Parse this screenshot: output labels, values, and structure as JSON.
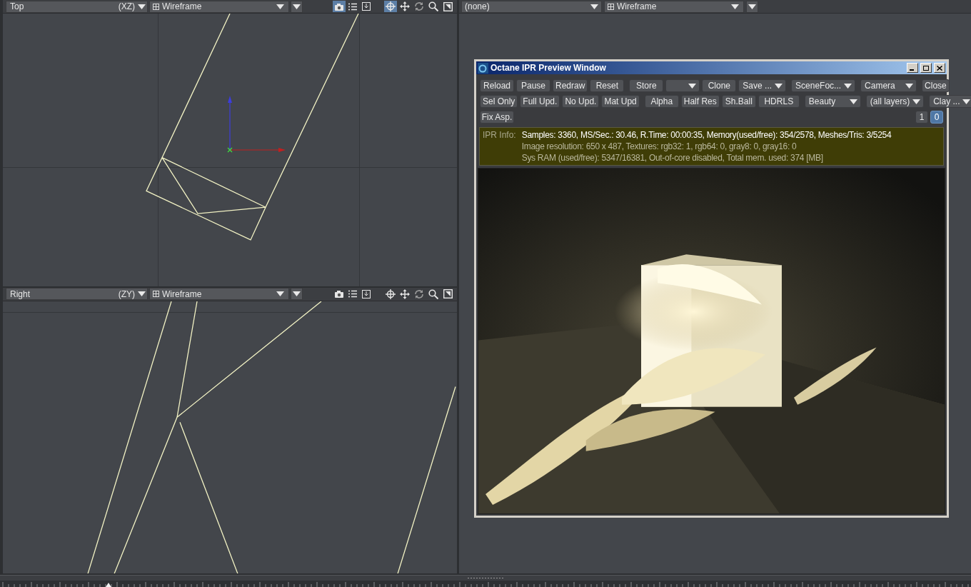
{
  "viewports": [
    {
      "view": "Top",
      "axes": "(XZ)",
      "mode": "Wireframe",
      "tools": [
        {
          "kind": "camera",
          "on": true
        },
        {
          "kind": "list",
          "on": false
        },
        {
          "kind": "save",
          "on": false
        },
        {
          "kind": "center",
          "on": true
        },
        {
          "kind": "move",
          "on": false
        },
        {
          "kind": "rotate",
          "on": false
        },
        {
          "kind": "zoom",
          "on": false
        },
        {
          "kind": "maximize",
          "on": false
        }
      ]
    },
    {
      "view": "Right",
      "axes": "(ZY)",
      "mode": "Wireframe",
      "tools": [
        {
          "kind": "camera",
          "on": false
        },
        {
          "kind": "list",
          "on": false
        },
        {
          "kind": "save",
          "on": false
        },
        {
          "kind": "center",
          "on": false
        },
        {
          "kind": "move",
          "on": false
        },
        {
          "kind": "rotate",
          "on": false
        },
        {
          "kind": "zoom",
          "on": false
        },
        {
          "kind": "maximize",
          "on": false
        }
      ]
    }
  ],
  "right_viewport": {
    "camera": "(none)",
    "mode": "Wireframe"
  },
  "ipr_window": {
    "title": "Octane IPR Preview Window",
    "toolbar": [
      [
        [
          {
            "kind": "button",
            "label": "Reload"
          },
          {
            "kind": "button",
            "label": "Pause"
          },
          {
            "kind": "button",
            "label": "Redraw"
          },
          {
            "kind": "button",
            "label": "Reset"
          }
        ],
        [
          {
            "kind": "button",
            "label": "Store"
          },
          {
            "kind": "dropdown"
          },
          {
            "kind": "button",
            "label": "Clone"
          },
          {
            "kind": "dropdown",
            "label": "Save ..."
          }
        ],
        [
          {
            "kind": "dropdown",
            "label": "SceneFoc..."
          },
          {
            "kind": "dropdown",
            "label": "Camera"
          }
        ],
        [
          {
            "kind": "button",
            "label": "Close"
          }
        ]
      ],
      [
        [
          {
            "kind": "button",
            "label": "Sel Only"
          },
          {
            "kind": "button",
            "label": "Full Upd."
          },
          {
            "kind": "button",
            "label": "No Upd."
          },
          {
            "kind": "button",
            "label": "Mat Upd"
          }
        ],
        [
          {
            "kind": "button",
            "label": "Alpha"
          },
          {
            "kind": "button",
            "label": "Half Res"
          },
          {
            "kind": "button",
            "label": "Sh.Ball"
          },
          {
            "kind": "button",
            "label": "HDRLS"
          }
        ],
        [
          {
            "kind": "dropdown",
            "label": "Beauty"
          },
          {
            "kind": "dropdown",
            "label": "(all layers)"
          }
        ],
        [
          {
            "kind": "dropdown",
            "label": "Clay ..."
          }
        ]
      ]
    ],
    "extra_button": "Fix Asp.",
    "pages": [
      {
        "label": "1",
        "selected": false
      },
      {
        "label": "0",
        "selected": true
      }
    ],
    "info": {
      "label": "IPR Info:",
      "lines": [
        "Samples: 3360, MS/Sec.: 30.46, R.Time: 00:00:35, Memory(used/free): 354/2578, Meshes/Tris: 3/5254",
        "Image resolution: 650 x 487, Textures:  rgb32: 1, rgb64: 0, gray8: 0, gray16: 0",
        "Sys RAM (used/free): 5347/16381, Out-of-core disabled, Total mem. used: 374  [MB]"
      ]
    }
  }
}
